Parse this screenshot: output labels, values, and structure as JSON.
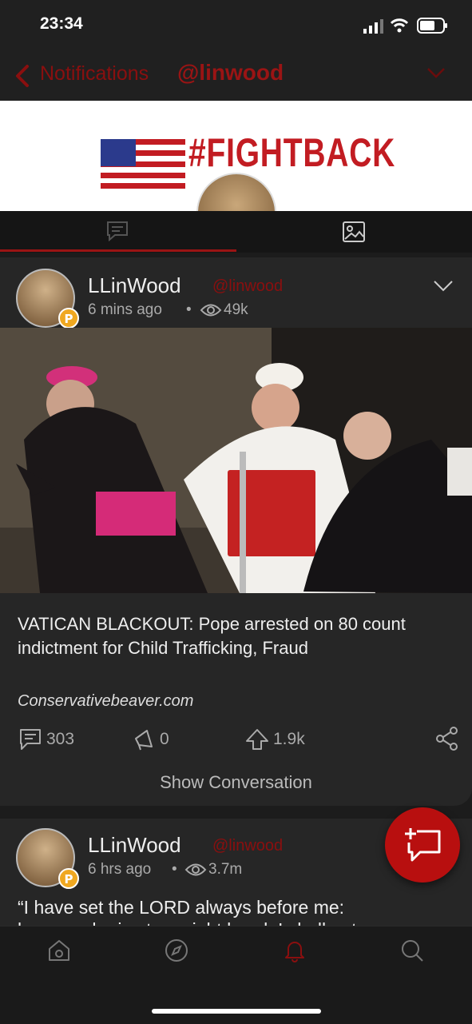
{
  "status": {
    "time": "23:34"
  },
  "nav": {
    "back_label": "Notifications",
    "handle": "@linwood"
  },
  "banner": {
    "text": "#FIGHTBACK"
  },
  "posts": [
    {
      "name": "LLinWood",
      "handle": "@linwood",
      "time": "6 mins ago",
      "views": "49k",
      "headline": "VATICAN BLACKOUT: Pope arrested on 80 count indictment for Child Trafficking, Fraud",
      "source": "Conservativebeaver.com",
      "comments": "303",
      "echoes": "0",
      "upvotes": "1.9k",
      "show_conversation": "Show Conversation"
    },
    {
      "name": "LLinWood",
      "handle": "@linwood",
      "time": "6 hrs ago",
      "views": "3.7m",
      "quote_line1": "“I have set the LORD always before me:",
      "quote_line2": "because he is at my right hand, I shall not"
    }
  ],
  "badge_letter": "P",
  "colors": {
    "accent": "#9a1414",
    "fab": "#b80f0f",
    "banner_red": "#c21c22"
  }
}
